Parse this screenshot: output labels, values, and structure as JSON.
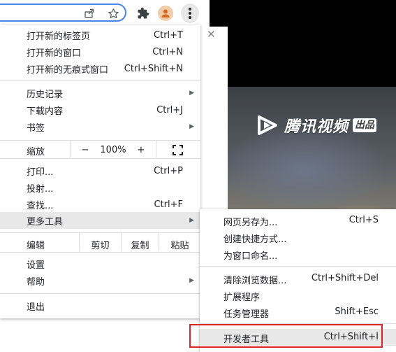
{
  "menu": {
    "items": [
      {
        "label": "打开新的标签页",
        "shortcut": "Ctrl+T"
      },
      {
        "label": "打开新的窗口",
        "shortcut": "Ctrl+N"
      },
      {
        "label": "打开新的无痕式窗口",
        "shortcut": "Ctrl+Shift+N"
      },
      {
        "label": "历史记录",
        "shortcut": ""
      },
      {
        "label": "下载内容",
        "shortcut": "Ctrl+J"
      },
      {
        "label": "书签",
        "shortcut": ""
      },
      {
        "label": "打印...",
        "shortcut": "Ctrl+P"
      },
      {
        "label": "投射...",
        "shortcut": ""
      },
      {
        "label": "查找...",
        "shortcut": "Ctrl+F"
      },
      {
        "label": "更多工具",
        "shortcut": ""
      },
      {
        "label": "设置",
        "shortcut": ""
      },
      {
        "label": "帮助",
        "shortcut": ""
      },
      {
        "label": "退出",
        "shortcut": ""
      }
    ],
    "zoom": {
      "label": "缩放",
      "minus": "−",
      "value": "100%",
      "plus": "+"
    },
    "edit": {
      "label": "编辑",
      "cut": "剪切",
      "copy": "复制",
      "paste": "粘贴"
    }
  },
  "submenu": {
    "items": [
      {
        "label": "网页另存为...",
        "shortcut": "Ctrl+S"
      },
      {
        "label": "创建快捷方式...",
        "shortcut": ""
      },
      {
        "label": "为窗口命名...",
        "shortcut": ""
      },
      {
        "label": "清除浏览数据...",
        "shortcut": "Ctrl+Shift+Del"
      },
      {
        "label": "扩展程序",
        "shortcut": ""
      },
      {
        "label": "任务管理器",
        "shortcut": "Shift+Esc"
      },
      {
        "label": "开发者工具",
        "shortcut": "Ctrl+Shift+I"
      }
    ]
  },
  "video": {
    "logo_text": "腾讯视频",
    "logo_badge": "出品"
  },
  "colors": {
    "highlight_border": "#d9262b",
    "omnibox_border": "#4b86e8",
    "active_item_bg": "#e8e8e8",
    "avatar_bg": "#f2cba9"
  },
  "icons": [
    "share-icon",
    "star-icon",
    "extensions-icon",
    "profile-icon",
    "kebab-menu-icon",
    "fullscreen-icon",
    "submenu-arrow-icon",
    "close-icon",
    "tencent-video-play-icon"
  ]
}
